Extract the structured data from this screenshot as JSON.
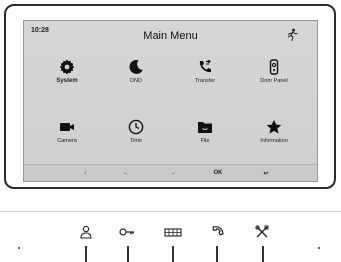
{
  "status": {
    "time": "10:28"
  },
  "header": {
    "title": "Main Menu",
    "right_icon": "running-person-icon"
  },
  "menu_items": [
    {
      "label": "System",
      "icon": "gear-icon"
    },
    {
      "label": "DND",
      "icon": "moon-icon"
    },
    {
      "label": "Transfer",
      "icon": "phone-forward-icon"
    },
    {
      "label": "Door Panel",
      "icon": "door-panel-icon"
    },
    {
      "label": "Camera",
      "icon": "video-camera-icon"
    },
    {
      "label": "Time",
      "icon": "clock-icon"
    },
    {
      "label": "File",
      "icon": "folder-icon"
    },
    {
      "label": "Information",
      "icon": "star-icon"
    }
  ],
  "navbar": {
    "down": "↓",
    "left": "←",
    "right": "→",
    "ok": "OK",
    "back": "↩"
  },
  "hardware_buttons": [
    {
      "icon": "person-icon"
    },
    {
      "icon": "key-icon"
    },
    {
      "icon": "gate-icon"
    },
    {
      "icon": "handset-icon"
    },
    {
      "icon": "tools-icon"
    }
  ],
  "colors": {
    "screen_bg": "#d3d3d3",
    "icon": "#111111",
    "bezel": "#2b2b2b"
  }
}
